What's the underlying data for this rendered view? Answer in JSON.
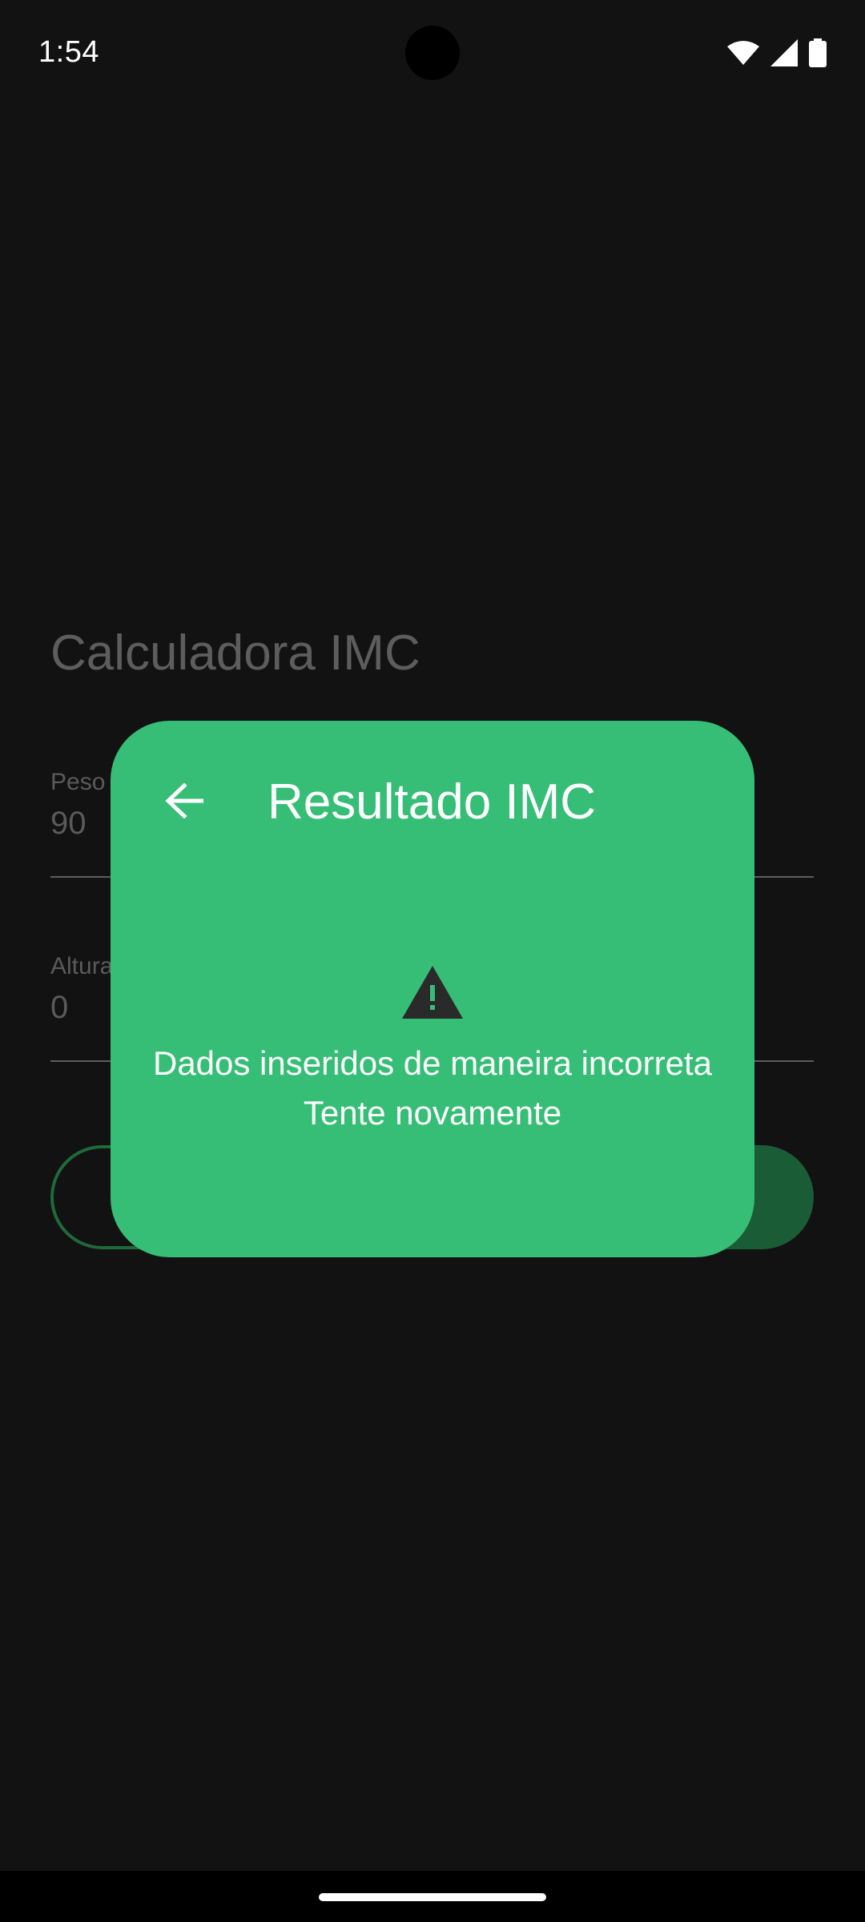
{
  "status_bar": {
    "time": "1:54",
    "icons": [
      "wifi-icon",
      "signal-icon",
      "battery-icon"
    ]
  },
  "app": {
    "title": "Calculadora IMC",
    "fields": [
      {
        "label": "Peso",
        "value": "90"
      },
      {
        "label": "Altura",
        "value": "0"
      }
    ]
  },
  "dialog": {
    "title": "Resultado IMC",
    "icon": "warning-icon",
    "message_line1": "Dados inseridos de maneira incorreta",
    "message_line2": "Tente novamente",
    "background_color": "#36be76"
  },
  "colors": {
    "background": "#121212",
    "accent": "#36be76",
    "accent_dark": "#1a5c36"
  }
}
